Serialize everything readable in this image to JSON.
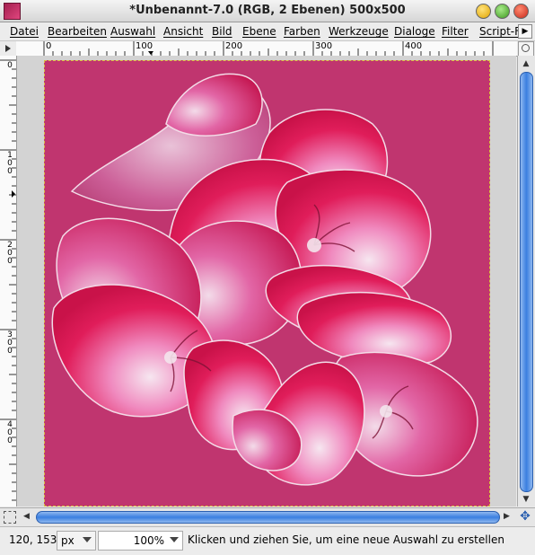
{
  "window": {
    "title": "*Unbenannt-7.0 (RGB, 2 Ebenen) 500x500"
  },
  "menu": {
    "items": [
      "Datei",
      "Bearbeiten",
      "Auswahl",
      "Ansicht",
      "Bild",
      "Ebene",
      "Farben",
      "Werkzeuge",
      "Dialoge",
      "Filter",
      "Script-Fu"
    ]
  },
  "ruler": {
    "h_labels": [
      "0",
      "100",
      "200",
      "300",
      "400"
    ],
    "v_labels": [
      "0",
      "100",
      "200",
      "300",
      "400"
    ]
  },
  "status": {
    "coords": "120, 153",
    "unit": "px",
    "zoom": "100%",
    "message": "Klicken und ziehen Sie, um eine neue Auswahl zu erstellen"
  },
  "colors": {
    "canvas_background": "#c0356f",
    "petal_main": "#e01d5a",
    "petal_light": "#f2a9d0",
    "accent_blue": "#3a7fe0"
  },
  "icons": {
    "app": "gimp-icon",
    "minimize": "minimize-icon",
    "maximize": "maximize-icon",
    "close": "close-icon",
    "navigate": "navigate-icon",
    "quickmask": "quick-mask-icon"
  }
}
